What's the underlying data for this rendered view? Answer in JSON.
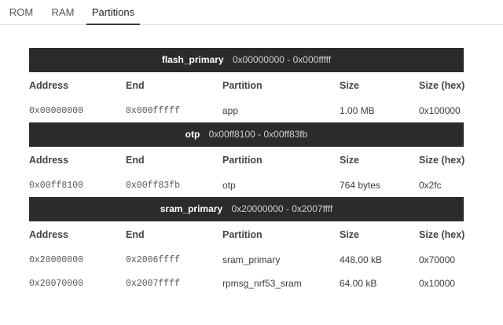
{
  "tabs": [
    {
      "label": "ROM",
      "active": false
    },
    {
      "label": "RAM",
      "active": false
    },
    {
      "label": "Partitions",
      "active": true
    }
  ],
  "columns": {
    "address": "Address",
    "end": "End",
    "partition": "Partition",
    "size": "Size",
    "size_hex": "Size (hex)"
  },
  "regions": [
    {
      "name": "flash_primary",
      "range": "0x00000000 - 0x000fffff",
      "rows": [
        {
          "address": "0x00000000",
          "end": "0x000fffff",
          "partition": "app",
          "size": "1.00 MB",
          "size_hex": "0x100000"
        }
      ]
    },
    {
      "name": "otp",
      "range": "0x00ff8100 - 0x00ff83fb",
      "rows": [
        {
          "address": "0x00ff8100",
          "end": "0x00ff83fb",
          "partition": "otp",
          "size": "764 bytes",
          "size_hex": "0x2fc"
        }
      ]
    },
    {
      "name": "sram_primary",
      "range": "0x20000000 - 0x2007ffff",
      "rows": [
        {
          "address": "0x20000000",
          "end": "0x2006ffff",
          "partition": "sram_primary",
          "size": "448.00 kB",
          "size_hex": "0x70000"
        },
        {
          "address": "0x20070000",
          "end": "0x2007ffff",
          "partition": "rpmsg_nrf53_sram",
          "size": "64.00 kB",
          "size_hex": "0x10000"
        }
      ]
    }
  ]
}
